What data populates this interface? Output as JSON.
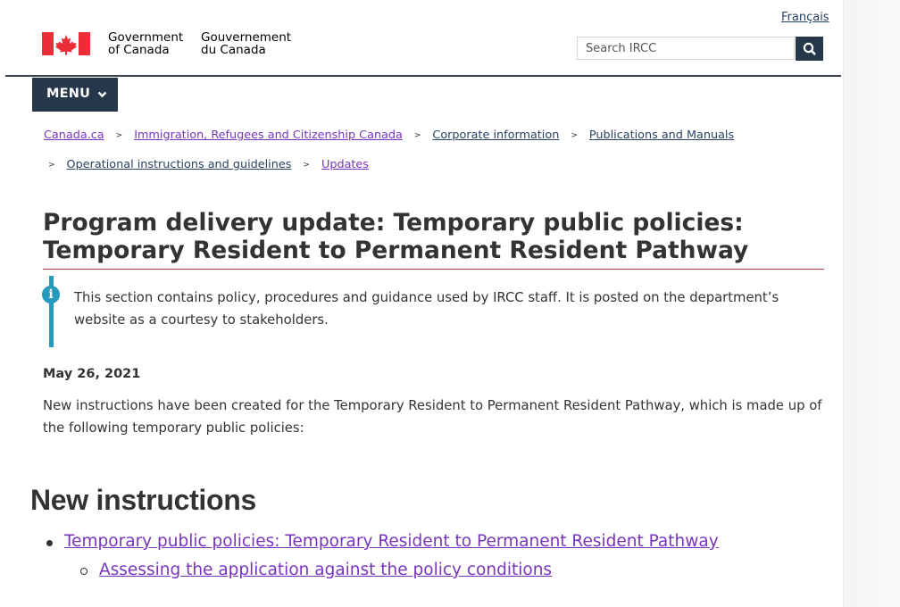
{
  "header": {
    "language_link": "Français",
    "signature_en_line1": "Government",
    "signature_en_line2": "of Canada",
    "signature_fr_line1": "Gouvernement",
    "signature_fr_line2": "du Canada",
    "search_placeholder": "Search IRCC"
  },
  "menu": {
    "label": "MENU"
  },
  "breadcrumbs": [
    "Canada.ca",
    "Immigration, Refugees and Citizenship Canada",
    "Corporate information",
    "Publications and Manuals",
    "Operational instructions and guidelines",
    "Updates"
  ],
  "main": {
    "title": "Program delivery update: Temporary public policies: Temporary Resident to Permanent Resident Pathway",
    "alert_text": "This section contains policy, procedures and guidance used by IRCC staff. It is posted on the department’s website as a courtesy to stakeholders.",
    "date": "May 26, 2021",
    "intro": "New instructions have been created for the Temporary Resident to Permanent Resident Pathway, which is made up of the following temporary public policies:",
    "section_heading": "New instructions",
    "list": [
      {
        "label": "Temporary public policies: Temporary Resident to Permanent Resident Pathway",
        "children": [
          "Assessing the application against the policy conditions"
        ]
      }
    ]
  },
  "colors": {
    "brand_dark": "#26374a",
    "link": "#284162",
    "visited_link": "#7834bc",
    "title_rule": "#af3c43",
    "info": "#269abc",
    "flag_red": "#eb2d37"
  },
  "icons": [
    "canada-flag-icon",
    "search-icon",
    "chevron-down-icon",
    "info-icon"
  ]
}
